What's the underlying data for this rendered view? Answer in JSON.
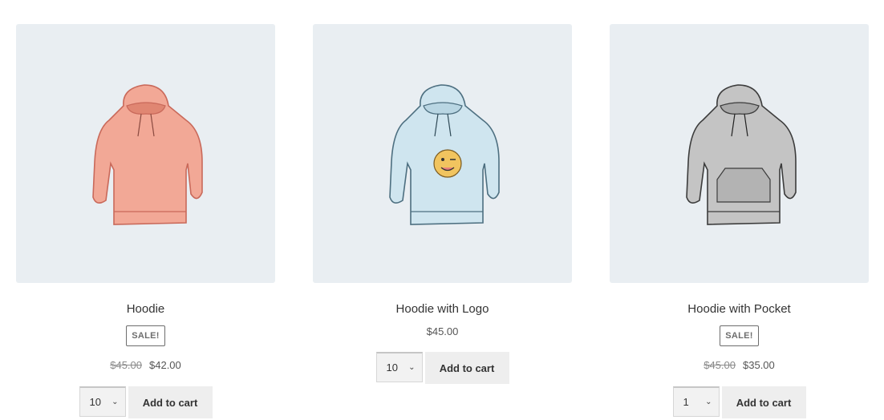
{
  "products": [
    {
      "title": "Hoodie",
      "badge": "SALE!",
      "old_price": "$45.00",
      "price": "$42.00",
      "quantity": "10",
      "button": "Add to cart",
      "color": "#f2a896",
      "outline": "#c9695a"
    },
    {
      "title": "Hoodie with Logo",
      "price": "$45.00",
      "quantity": "10",
      "button": "Add to cart",
      "color": "#cfe5ef",
      "outline": "#4d6f80"
    },
    {
      "title": "Hoodie with Pocket",
      "badge": "SALE!",
      "old_price": "$45.00",
      "price": "$35.00",
      "quantity": "1",
      "button": "Add to cart",
      "color": "#c4c4c4",
      "outline": "#3c3c3c"
    }
  ]
}
